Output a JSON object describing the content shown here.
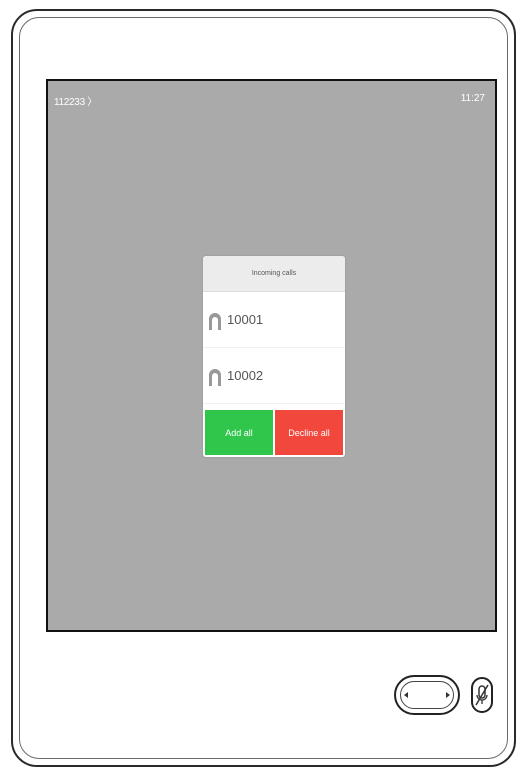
{
  "status_bar": {
    "left_text": "112233 〉",
    "time": "11:27"
  },
  "dialog": {
    "title": "Incoming calls",
    "calls": [
      {
        "number": "10001",
        "icon": "person-silhouette-icon"
      },
      {
        "number": "10002",
        "icon": "person-silhouette-icon"
      }
    ],
    "add_all_label": "Add all",
    "decline_all_label": "Decline all"
  },
  "hardware": {
    "volume_icon": "volume-rocker-icon",
    "mute_icon": "microphone-mute-icon"
  },
  "colors": {
    "screen_bg": "#aaaaaa",
    "add_all": "#30c54b",
    "decline_all": "#f2473c"
  }
}
